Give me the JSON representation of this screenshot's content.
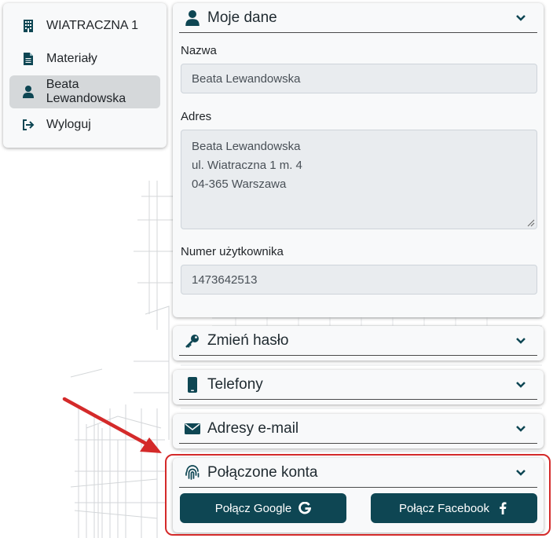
{
  "sidebar": {
    "items": [
      {
        "label": "WIATRACZNA 1",
        "icon": "building-icon"
      },
      {
        "label": "Materiały",
        "icon": "document-icon"
      },
      {
        "label": "Beata Lewandowska",
        "icon": "user-icon",
        "active": true
      },
      {
        "label": "Wyloguj",
        "icon": "logout-icon"
      }
    ]
  },
  "moje_dane": {
    "title": "Moje dane",
    "name_label": "Nazwa",
    "name_value": "Beata Lewandowska",
    "address_label": "Adres",
    "address_lines": [
      "Beata Lewandowska",
      "ul. Wiatraczna 1 m. 4",
      "04-365 Warszawa"
    ],
    "user_number_label": "Numer użytkownika",
    "user_number_value": "1473642513"
  },
  "sections": {
    "password": {
      "title": "Zmień hasło",
      "icon": "key-icon"
    },
    "phones": {
      "title": "Telefony",
      "icon": "phone-icon"
    },
    "emails": {
      "title": "Adresy e-mail",
      "icon": "envelope-icon"
    },
    "connected": {
      "title": "Połączone konta",
      "icon": "fingerprint-icon"
    }
  },
  "buttons": {
    "google": "Połącz Google",
    "facebook": "Połącz Facebook"
  },
  "colors": {
    "brand": "#0e4653",
    "highlight": "#d42a2a",
    "card_bg": "#f8f9fa",
    "input_bg": "#e9ecef"
  }
}
